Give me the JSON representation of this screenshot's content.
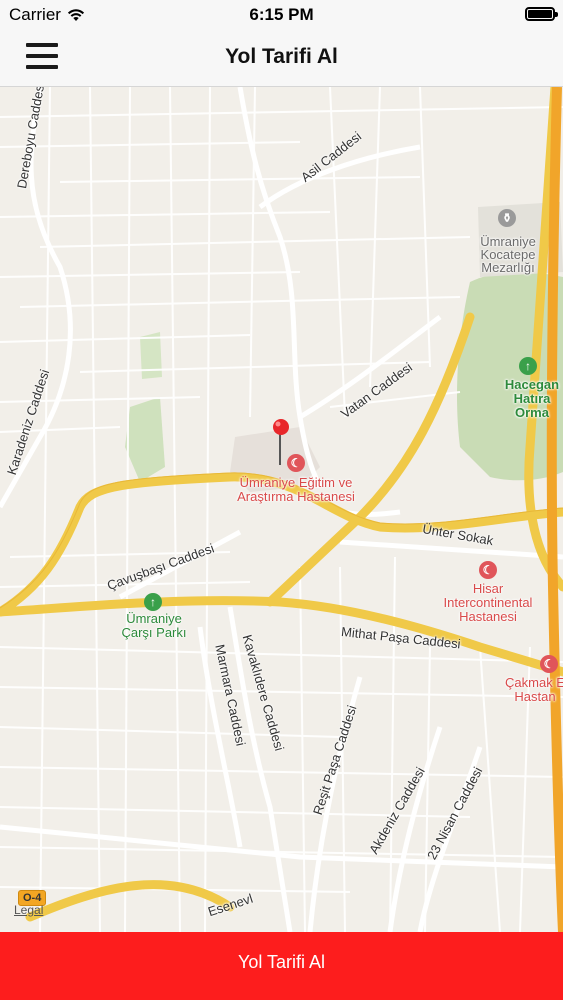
{
  "status_bar": {
    "carrier": "Carrier",
    "time": "6:15 PM",
    "battery_level": 1.0
  },
  "nav": {
    "title": "Yol Tarifi Al"
  },
  "map": {
    "streets": [
      "Dereboyu Caddesi",
      "Asil Caddesi",
      "Karadeniz Caddesi",
      "Vatan Caddesi",
      "Çavuşbaşı Caddesi",
      "Ünter Sokak",
      "Mithat Paşa Caddesi",
      "Marmara Caddesi",
      "Kavaklıdere Caddesi",
      "Reşit Paşa Caddesi",
      "Akdeniz Caddesi",
      "23 Nisan Caddesi",
      "Esenevl"
    ],
    "pois": {
      "cemetery": "Ümraniye Kocatepe Mezarlığı",
      "grove": "Hacegan Hatıra Orma",
      "hospital1": "Ümraniye Eğitim ve Araştırma Hastanesi",
      "park": "Ümraniye Çarşı Parkı",
      "hospital2": "Hisar Intercontinental Hastanesi",
      "hospital3": "Çakmak E Hastan"
    },
    "highway_shield": "O-4",
    "legal": "Legal"
  },
  "action": {
    "label": "Yol Tarifi Al"
  }
}
